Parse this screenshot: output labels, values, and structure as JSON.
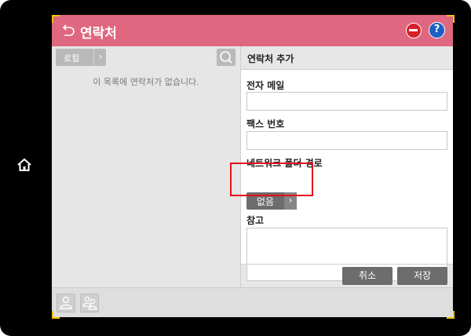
{
  "title": "연락처",
  "left_panel": {
    "local_button_label": "로컬",
    "empty_message": "이 목록에 연락처가 없습니다."
  },
  "right_panel": {
    "heading": "연락처 추가",
    "email_label": "전자 메일",
    "email_value": "",
    "fax_label": "팩스 번호",
    "fax_value": "",
    "network_folder_label": "네트워크 폴더 경로",
    "network_folder_value": "없음",
    "notes_label": "참고",
    "notes_value": ""
  },
  "buttons": {
    "cancel": "취소",
    "save": "저장"
  },
  "colors": {
    "title_bar": "#df6780",
    "stop": "#d6202a",
    "help": "#1d5fc2",
    "highlight": "#e3101c"
  },
  "icons": [
    "home-icon",
    "back-icon",
    "stop-icon",
    "help-icon",
    "search-icon",
    "add-contact-icon",
    "add-group-icon",
    "chevron-right-icon"
  ]
}
